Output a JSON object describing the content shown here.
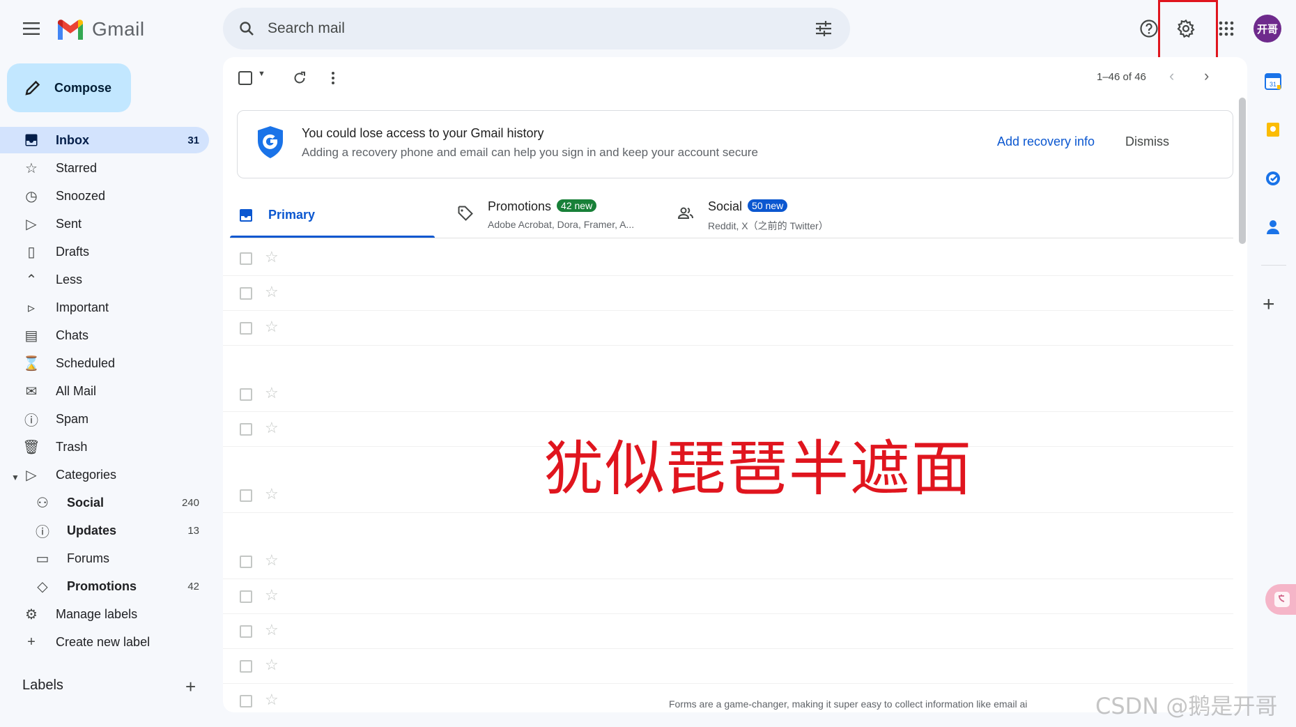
{
  "header": {
    "app_name": "Gmail",
    "search_placeholder": "Search mail",
    "avatar_text": "开哥"
  },
  "sidebar": {
    "compose_label": "Compose",
    "items": [
      {
        "name": "nav-inbox",
        "icon": "inbox-icon",
        "label": "Inbox",
        "count": "31"
      },
      {
        "name": "nav-starred",
        "icon": "star-icon",
        "label": "Starred",
        "count": ""
      },
      {
        "name": "nav-snoozed",
        "icon": "clock-icon",
        "label": "Snoozed",
        "count": ""
      },
      {
        "name": "nav-sent",
        "icon": "send-icon",
        "label": "Sent",
        "count": ""
      },
      {
        "name": "nav-drafts",
        "icon": "draft-icon",
        "label": "Drafts",
        "count": ""
      },
      {
        "name": "nav-less",
        "icon": "chevron-up-icon",
        "label": "Less",
        "count": ""
      },
      {
        "name": "nav-important",
        "icon": "important-icon",
        "label": "Important",
        "count": ""
      },
      {
        "name": "nav-chats",
        "icon": "chat-icon",
        "label": "Chats",
        "count": ""
      },
      {
        "name": "nav-scheduled",
        "icon": "scheduled-icon",
        "label": "Scheduled",
        "count": ""
      },
      {
        "name": "nav-all-mail",
        "icon": "all-mail-icon",
        "label": "All Mail",
        "count": ""
      },
      {
        "name": "nav-spam",
        "icon": "spam-icon",
        "label": "Spam",
        "count": ""
      },
      {
        "name": "nav-trash",
        "icon": "trash-icon",
        "label": "Trash",
        "count": ""
      },
      {
        "name": "nav-categories",
        "icon": "label-icon",
        "label": "Categories",
        "count": ""
      }
    ],
    "categories": [
      {
        "name": "nav-social",
        "icon": "people-icon",
        "label": "Social",
        "count": "240",
        "bold": true
      },
      {
        "name": "nav-updates",
        "icon": "info-icon",
        "label": "Updates",
        "count": "13",
        "bold": true
      },
      {
        "name": "nav-forums",
        "icon": "forum-icon",
        "label": "Forums",
        "count": "",
        "bold": false
      },
      {
        "name": "nav-promotions",
        "icon": "tag-icon",
        "label": "Promotions",
        "count": "42",
        "bold": true
      }
    ],
    "footer_items": [
      {
        "name": "nav-manage-labels",
        "icon": "gear-icon",
        "label": "Manage labels"
      },
      {
        "name": "nav-create-label",
        "icon": "plus-icon",
        "label": "Create new label"
      }
    ],
    "labels_heading": "Labels"
  },
  "toolbar": {
    "pager": "1–46 of 46"
  },
  "banner": {
    "title": "You could lose access to your Gmail history",
    "subtitle": "Adding a recovery phone and email can help you sign in and keep your account secure",
    "primary_action": "Add recovery info",
    "secondary_action": "Dismiss"
  },
  "tabs": {
    "primary": {
      "label": "Primary"
    },
    "promotions": {
      "label": "Promotions",
      "badge": "42 new",
      "badge_color": "#188038",
      "senders": "Adobe Acrobat, Dora, Framer, A..."
    },
    "social": {
      "label": "Social",
      "badge": "50 new",
      "badge_color": "#0b57d0",
      "senders": "Reddit, X（之前的 Twitter）"
    }
  },
  "overlay_text": "犹似琵琶半遮面",
  "bottom_snippet": "Forms are a game-changer, making it super easy to collect information like email ai",
  "watermark": "CSDN @鹅是开哥",
  "colors": {
    "accent": "#0b57d0",
    "highlight_box": "#e0151e",
    "inbox_selected": "#d3e3fd",
    "compose_bg": "#c2e7ff"
  }
}
